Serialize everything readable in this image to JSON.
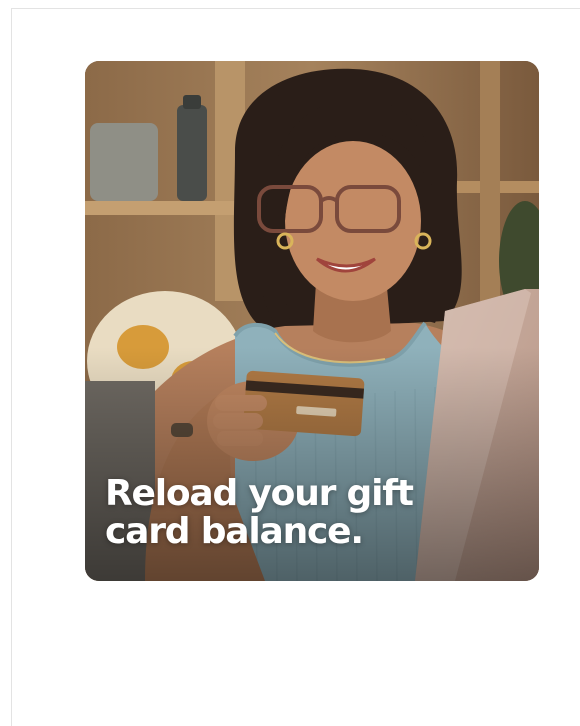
{
  "promo": {
    "headline": "Reload your gift card balance.",
    "image": "woman-holding-credit-card-at-laptop"
  },
  "colors": {
    "page_background": "#ffffff",
    "frame_border": "#e3e3e3",
    "headline_text": "#ffffff"
  }
}
